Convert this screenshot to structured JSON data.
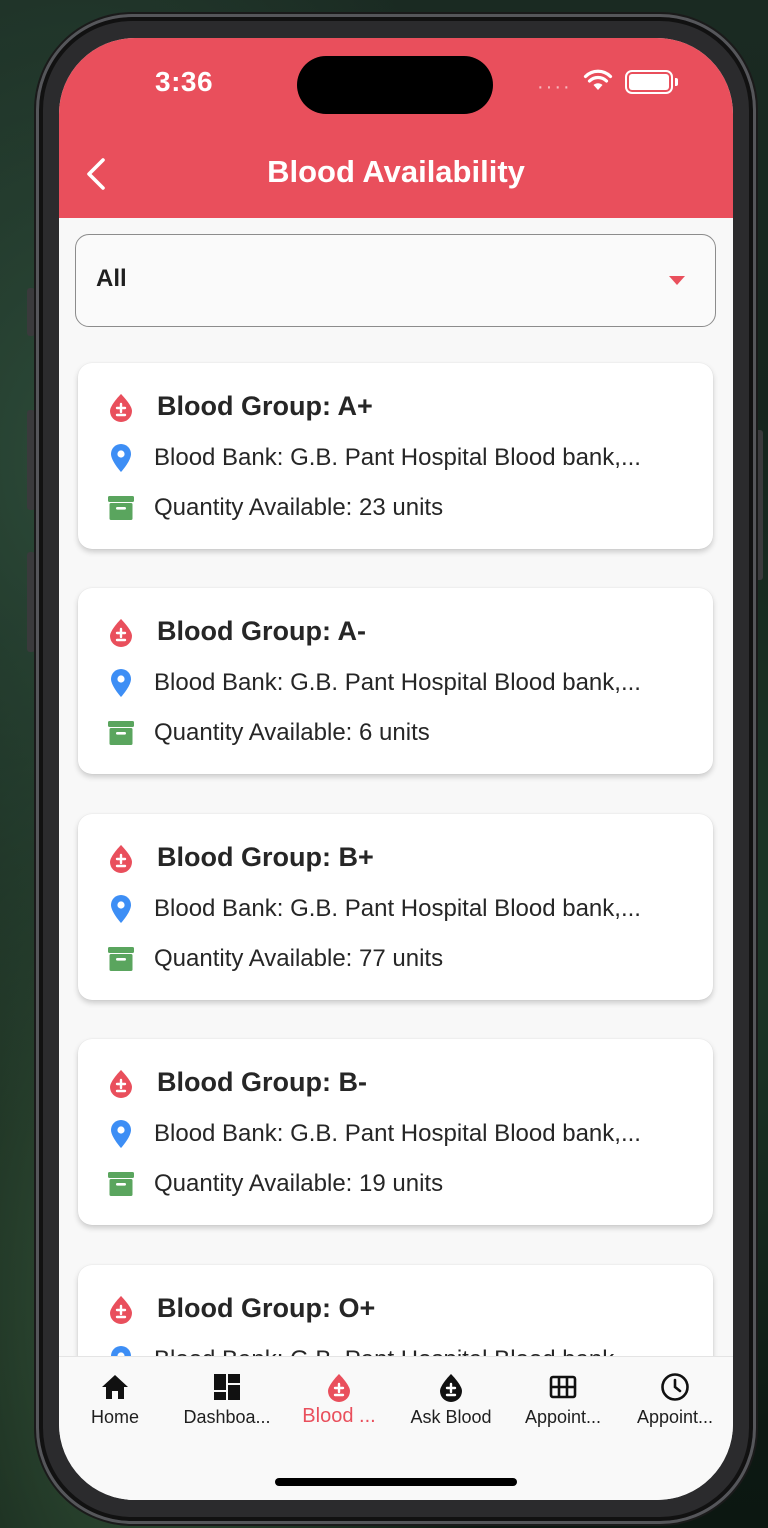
{
  "status_bar": {
    "time": "3:36"
  },
  "app_bar": {
    "title": "Blood Availability"
  },
  "filter": {
    "selected": "All"
  },
  "cards": [
    {
      "group": "Blood Group: A+",
      "bank": "Blood Bank: G.B. Pant Hospital Blood bank,...",
      "quantity": "Quantity Available: 23 units"
    },
    {
      "group": "Blood Group: A-",
      "bank": "Blood Bank: G.B. Pant Hospital Blood bank,...",
      "quantity": "Quantity Available: 6 units"
    },
    {
      "group": "Blood Group: B+",
      "bank": "Blood Bank: G.B. Pant Hospital Blood bank,...",
      "quantity": "Quantity Available: 77 units"
    },
    {
      "group": "Blood Group: B-",
      "bank": "Blood Bank: G.B. Pant Hospital Blood bank,...",
      "quantity": "Quantity Available: 19 units"
    },
    {
      "group": "Blood Group: O+",
      "bank": "Blood Bank: G.B. Pant Hospital Blood bank,...",
      "quantity": ""
    }
  ],
  "bottom_nav": [
    {
      "label": "Home",
      "icon": "home-icon",
      "active": false
    },
    {
      "label": "Dashboa...",
      "icon": "dashboard-icon",
      "active": false
    },
    {
      "label": "Blood ...",
      "icon": "blood-drop-icon",
      "active": true
    },
    {
      "label": "Ask Blood",
      "icon": "blood-drop-icon",
      "active": false
    },
    {
      "label": "Appoint...",
      "icon": "grid-icon",
      "active": false
    },
    {
      "label": "Appoint...",
      "icon": "clock-icon",
      "active": false
    }
  ],
  "colors": {
    "primary": "#e94f5c",
    "location_pin": "#3d8ef5",
    "quantity_box": "#5aa55e"
  }
}
